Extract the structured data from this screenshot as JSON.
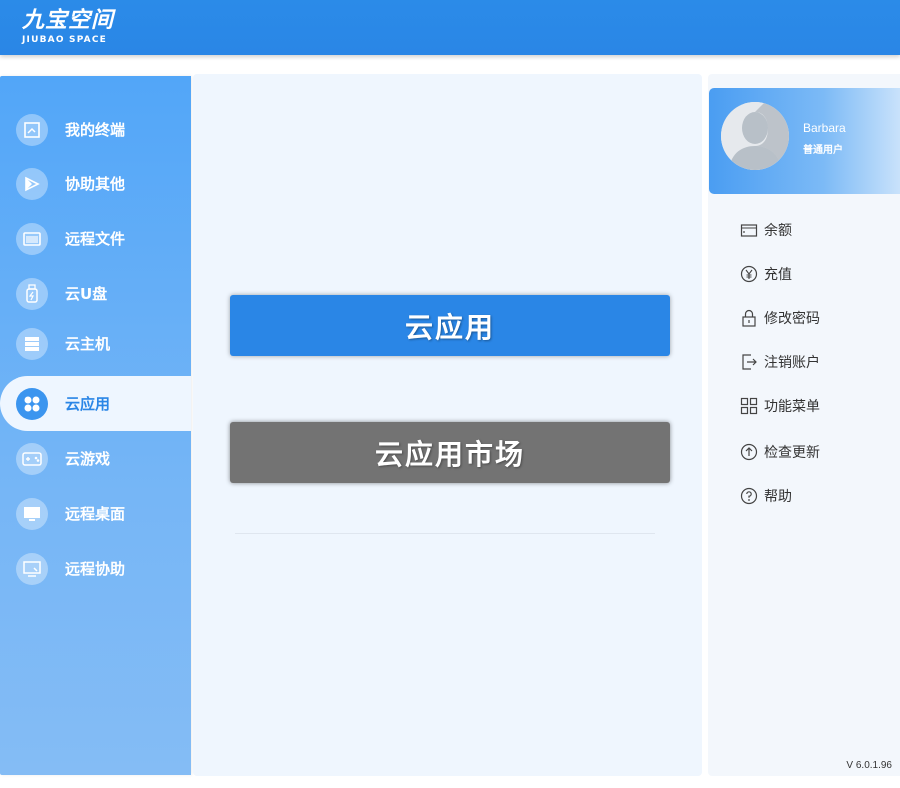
{
  "header": {
    "logo_cn": "九宝空间",
    "logo_en": "JIUBAO SPACE"
  },
  "sidebar": {
    "items": [
      {
        "label": "我的终端",
        "icon": "terminal-icon"
      },
      {
        "label": "协助其他",
        "icon": "assist-icon"
      },
      {
        "label": "远程文件",
        "icon": "folder-icon"
      },
      {
        "label": "云U盘",
        "icon": "usb-drive-icon"
      },
      {
        "label": "云主机",
        "icon": "server-icon"
      },
      {
        "label": "云应用",
        "icon": "apps-icon",
        "active": true
      },
      {
        "label": "云游戏",
        "icon": "gamepad-icon"
      },
      {
        "label": "远程桌面",
        "icon": "desktop-icon"
      },
      {
        "label": "远程协助",
        "icon": "remote-assist-icon"
      }
    ]
  },
  "main": {
    "cloud_app_button": "云应用",
    "market_button": "云应用市场"
  },
  "profile": {
    "username": "Barbara",
    "user_type": "普通用户"
  },
  "menu": {
    "items": [
      {
        "label": "余额",
        "icon": "wallet-icon"
      },
      {
        "label": "充值",
        "icon": "yen-icon"
      },
      {
        "label": "修改密码",
        "icon": "lock-icon"
      },
      {
        "label": "注销账户",
        "icon": "logout-icon"
      },
      {
        "label": "功能菜单",
        "icon": "grid-menu-icon"
      },
      {
        "label": "检查更新",
        "icon": "update-icon"
      },
      {
        "label": "帮助",
        "icon": "help-icon"
      }
    ]
  },
  "footer": {
    "version": "V 6.0.1.96"
  },
  "colors": {
    "accent": "#2a86e6",
    "sidebar_top": "#52a6f8",
    "market_button": "#737373",
    "main_bg": "#eff6fe"
  }
}
